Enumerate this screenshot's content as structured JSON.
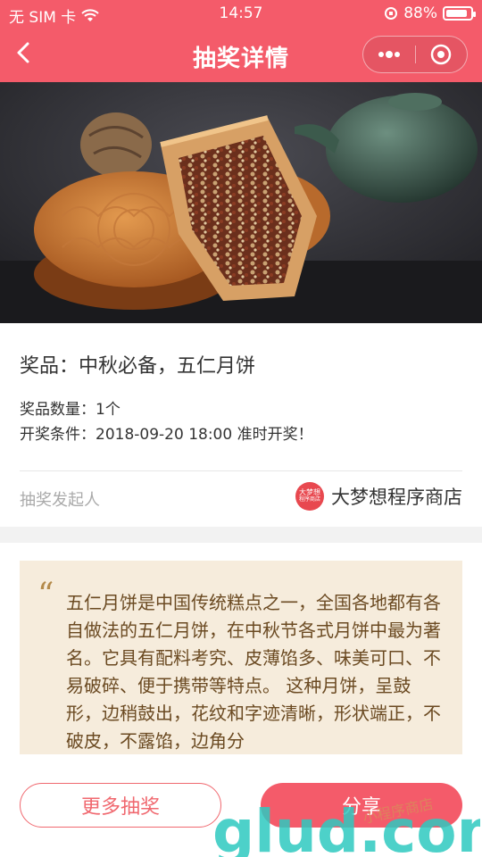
{
  "status": {
    "carrier": "无 SIM 卡",
    "time": "14:57",
    "battery": "88%",
    "battery_level": 0.88
  },
  "nav": {
    "title": "抽奖详情"
  },
  "prize": {
    "title": "奖品：中秋必备，五仁月饼",
    "quantity": "奖品数量：1个",
    "condition": "开奖条件：2018-09-20 18:00 准时开奖！"
  },
  "initiator": {
    "label": "抽奖发起人",
    "name": "大梦想程序商店",
    "avatar_text": "大梦想",
    "avatar_sub": "程序商店"
  },
  "description": {
    "quote": "“",
    "text": "五仁月饼是中国传统糕点之一，全国各地都有各自做法的五仁月饼，在中秋节各式月饼中最为著名。它具有配料考究、皮薄馅多、味美可口、不易破碎、便于携带等特点。 这种月饼，呈鼓形，边稍鼓出，花纹和字迹清晰，形状端正，不破皮，不露馅，边角分"
  },
  "actions": {
    "more": "更多抽奖",
    "share": "分享"
  },
  "watermark": {
    "text": "glud.com",
    "sub": "小程序商店"
  },
  "colors": {
    "brand": "#f45b6a",
    "card_bg": "#f6ecdc",
    "card_text": "#6b4a22"
  }
}
